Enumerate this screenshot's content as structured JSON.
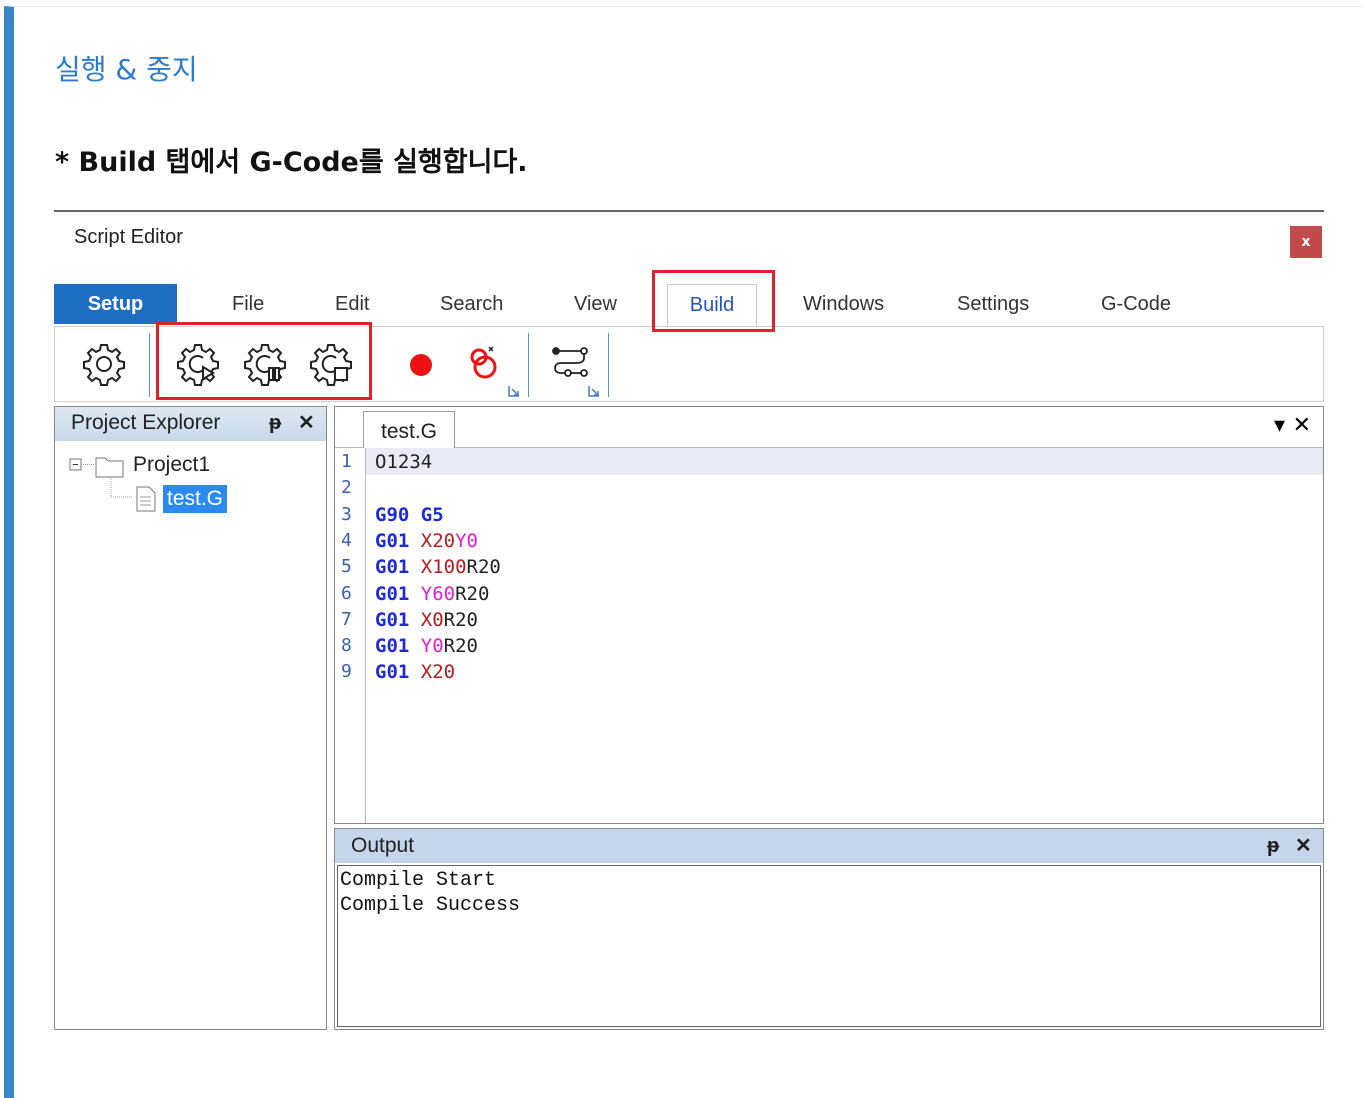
{
  "heading": "실행 & 중지",
  "instruction": "* Build 탭에서 G-Code를 실행합니다.",
  "window": {
    "title": "Script Editor",
    "close_label": "x"
  },
  "tabs": [
    "Setup",
    "File",
    "Edit",
    "Search",
    "View",
    "Build",
    "Windows",
    "Settings",
    "G-Code"
  ],
  "active_tab": "Build",
  "toolbar": {
    "icons": [
      "settings-icon",
      "compile-run-icon",
      "compile-pause-icon",
      "compile-stop-icon",
      "record-icon",
      "clear-breakpoint-icon",
      "flow-icon"
    ],
    "accent": "#e0202a"
  },
  "project_explorer": {
    "title": "Project Explorer",
    "pin": "ᵽ",
    "close": "✕",
    "project": "Project1",
    "file": "test.G"
  },
  "editor": {
    "tab": "test.G",
    "dropdown": "▾",
    "close": "✕",
    "line_numbers": [
      "1",
      "2",
      "3",
      "4",
      "5",
      "6",
      "7",
      "8",
      "9"
    ],
    "lines": [
      [
        {
          "t": "O1234",
          "c": "#222"
        }
      ],
      [],
      [
        {
          "t": "G90 G5",
          "c": "#1f2bd6",
          "b": true
        }
      ],
      [
        {
          "t": "G01 ",
          "c": "#1f2bd6",
          "b": true
        },
        {
          "t": "X20",
          "c": "#b02020"
        },
        {
          "t": "Y0",
          "c": "#e020d0"
        }
      ],
      [
        {
          "t": "G01 ",
          "c": "#1f2bd6",
          "b": true
        },
        {
          "t": "X100",
          "c": "#b02020"
        },
        {
          "t": "R20",
          "c": "#222"
        }
      ],
      [
        {
          "t": "G01 ",
          "c": "#1f2bd6",
          "b": true
        },
        {
          "t": "Y60",
          "c": "#e020d0"
        },
        {
          "t": "R20",
          "c": "#222"
        }
      ],
      [
        {
          "t": "G01 ",
          "c": "#1f2bd6",
          "b": true
        },
        {
          "t": "X0",
          "c": "#b02020"
        },
        {
          "t": "R20",
          "c": "#222"
        }
      ],
      [
        {
          "t": "G01 ",
          "c": "#1f2bd6",
          "b": true
        },
        {
          "t": "Y0",
          "c": "#e020d0"
        },
        {
          "t": "R20",
          "c": "#222"
        }
      ],
      [
        {
          "t": "G01 ",
          "c": "#1f2bd6",
          "b": true
        },
        {
          "t": "X20",
          "c": "#b02020"
        }
      ]
    ]
  },
  "output": {
    "title": "Output",
    "pin": "ᵽ",
    "close": "✕",
    "lines": [
      "Compile Start",
      "Compile Success"
    ]
  }
}
